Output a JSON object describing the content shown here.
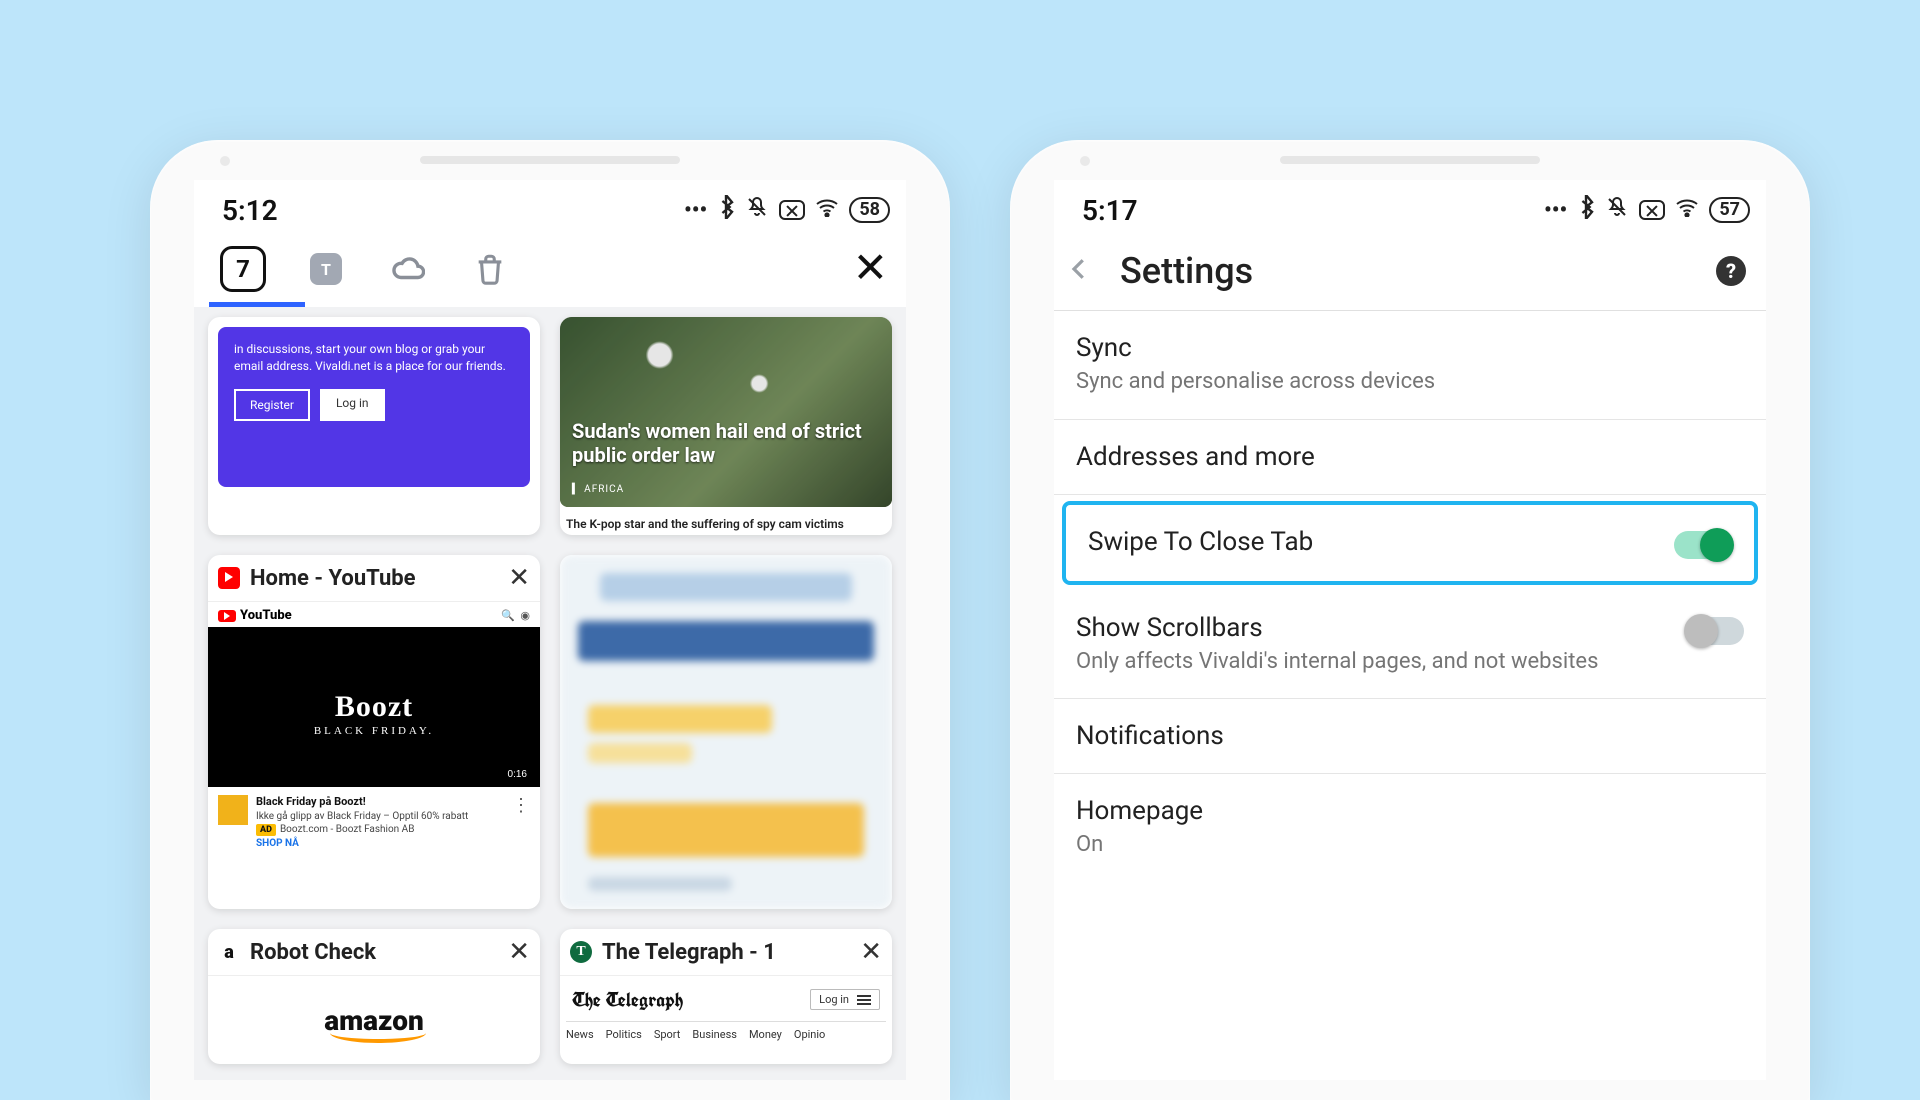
{
  "left": {
    "time": "5:12",
    "battery": "58",
    "tab_count": "7",
    "row1": {
      "vivaldi_text": "in discussions, start your own blog or grab your email address. Vivaldi.net is a place for our friends.",
      "vivaldi_register": "Register",
      "vivaldi_login": "Log in",
      "news_headline": "Sudan's women hail end of strict public order law",
      "news_tag": "▍ AFRICA",
      "news_sub": "The K-pop star and the suffering of spy cam victims"
    },
    "yt": {
      "title": "Home - YouTube",
      "logo": "YouTube",
      "brand": "Boozt",
      "brand_sub": "BLACK FRIDAY.",
      "duration": "0:16",
      "meta_title": "Black Friday på Boozt!",
      "meta_line": "Ikke gå glipp av Black Friday – Opptil 60% rabatt",
      "meta_src": "Boozt.com - Boozt Fashion AB",
      "ad": "AD",
      "shop": "SHOP NÅ"
    },
    "amazon": {
      "title": "Robot Check",
      "word": "amazon"
    },
    "telegraph": {
      "title": "The Telegraph - 1",
      "masthead": "The Telegraph",
      "login": "Log in",
      "nav": [
        "News",
        "Politics",
        "Sport",
        "Business",
        "Money",
        "Opinio"
      ]
    }
  },
  "right": {
    "time": "5:17",
    "battery": "57",
    "title": "Settings",
    "rows": {
      "sync": {
        "label": "Sync",
        "sub": "Sync and personalise across devices"
      },
      "addresses": {
        "label": "Addresses and more"
      },
      "swipe": {
        "label": "Swipe To Close Tab"
      },
      "scrollbars": {
        "label": "Show Scrollbars",
        "sub": "Only affects Vivaldi's internal pages, and not websites"
      },
      "notifications": {
        "label": "Notifications"
      },
      "homepage": {
        "label": "Homepage",
        "sub": "On"
      }
    }
  }
}
